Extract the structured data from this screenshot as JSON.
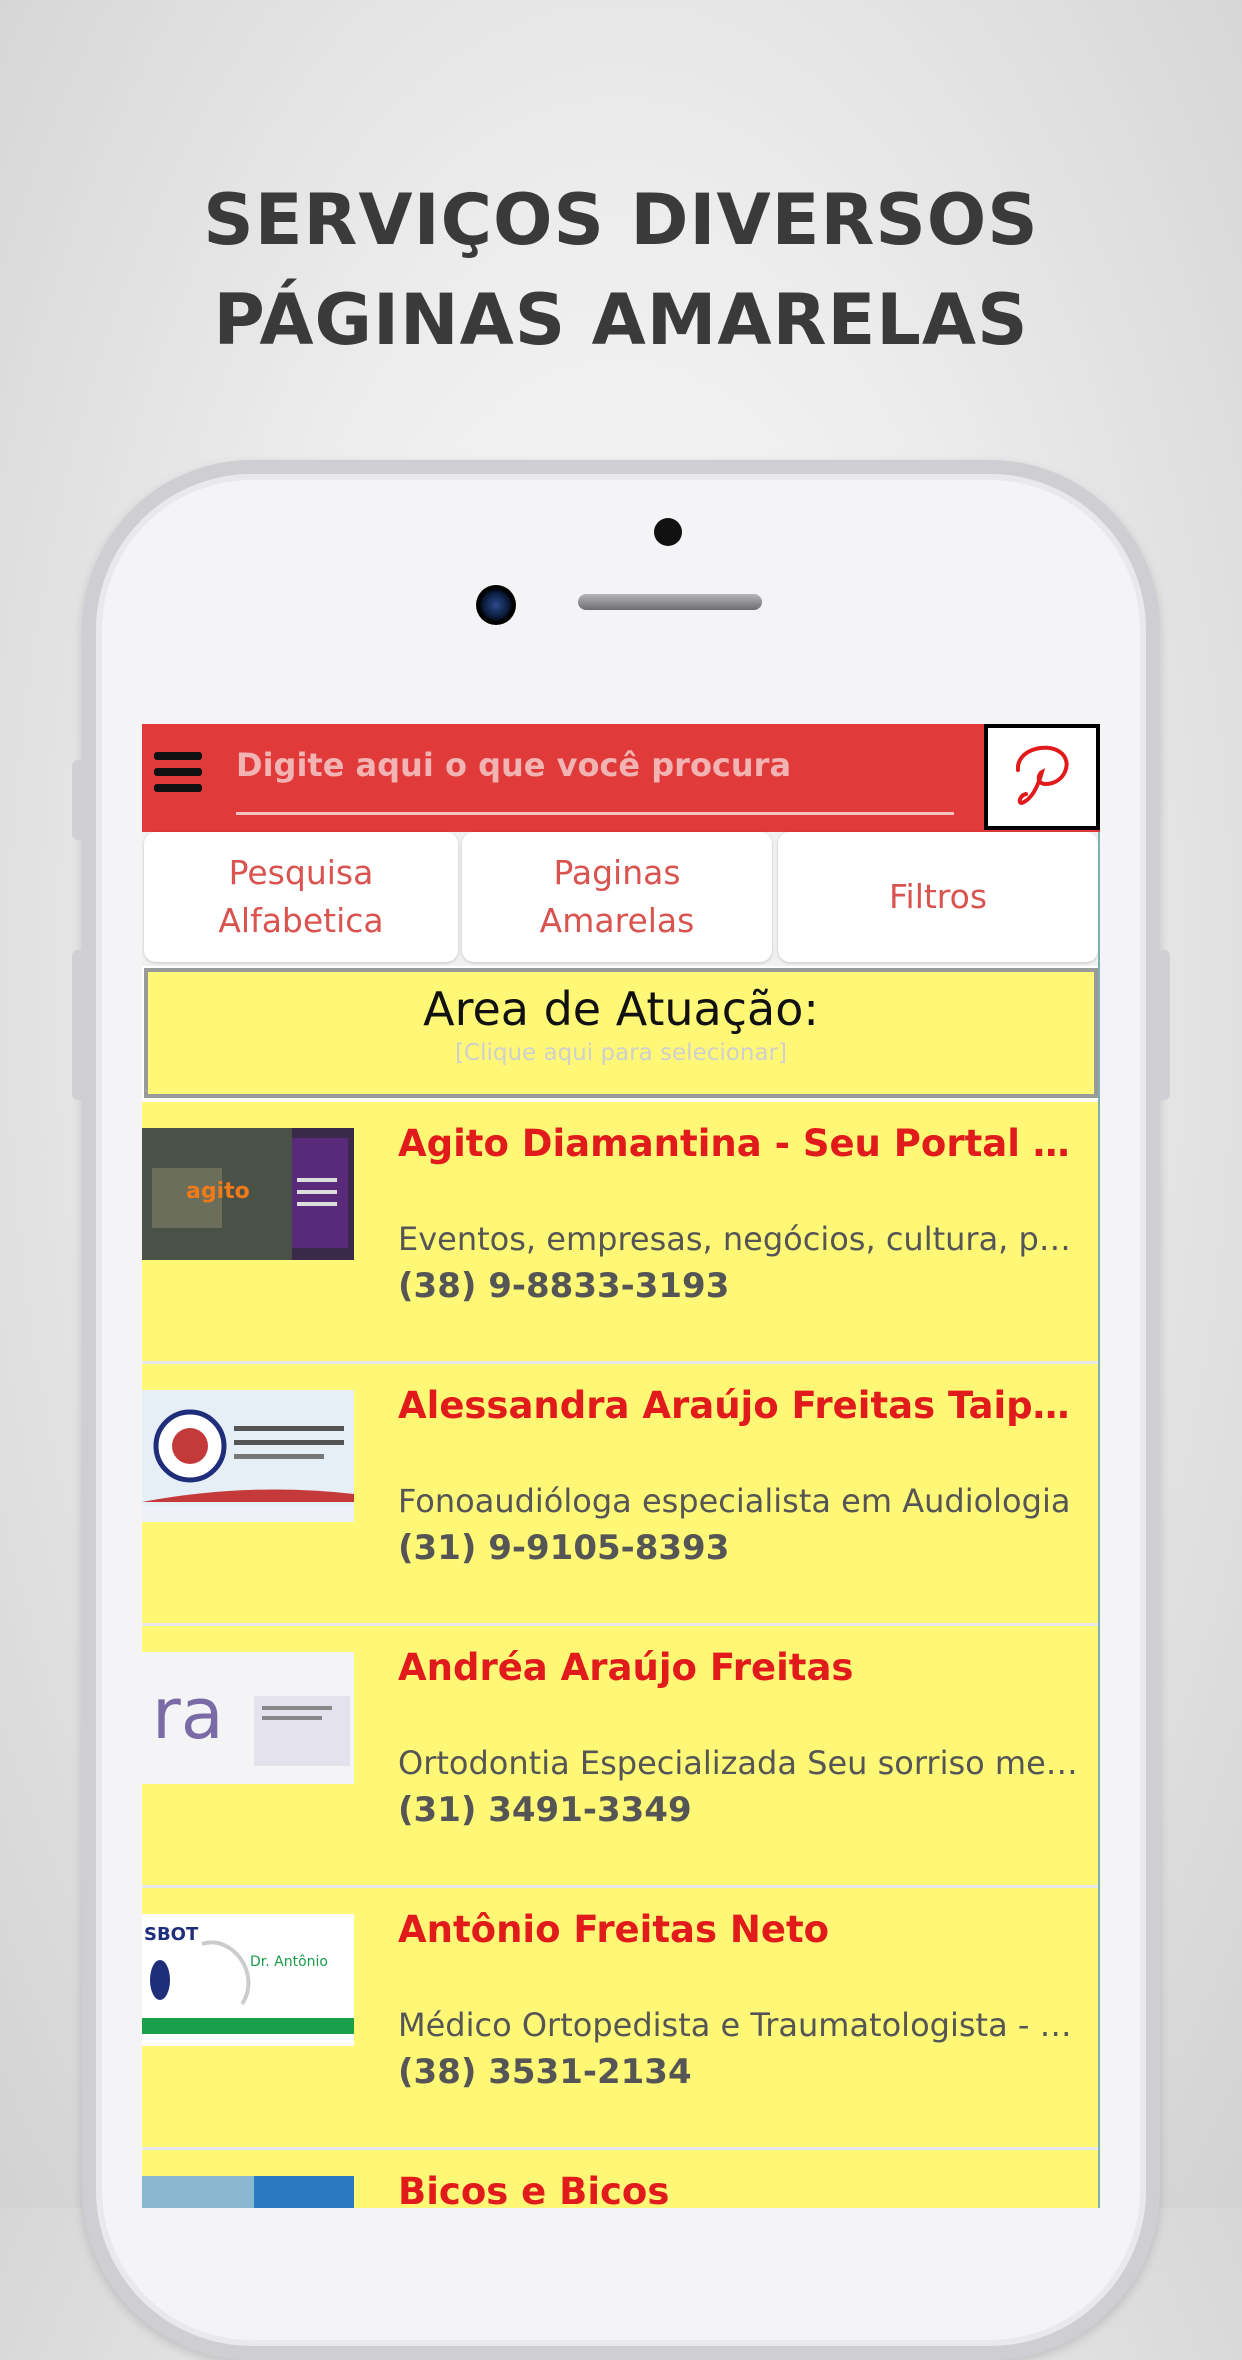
{
  "headline": {
    "line1": "SERVIÇOS DIVERSOS",
    "line2": "PÁGINAS AMARELAS"
  },
  "colors": {
    "topbar": "#e03a3a",
    "yellow": "#fef876",
    "title_red": "#e11b1b",
    "tab_text": "#d9534f"
  },
  "topbar": {
    "menu_icon": "hamburger-icon",
    "search_placeholder": "Digite aqui o que você procura",
    "logo_icon": "app-logo-icon"
  },
  "tabs": [
    {
      "label": "Pesquisa\nAlfabetica"
    },
    {
      "label": "Paginas\nAmarelas"
    },
    {
      "label": "Filtros"
    }
  ],
  "area": {
    "title": "Area de Atuação:",
    "hint": "[Clique aqui para selecionar]"
  },
  "listings": [
    {
      "title": "Agito Diamantina - Seu Portal de Eventos",
      "description": "Eventos, empresas, negócios, cultura, passeios",
      "phone": "(38) 9-8833-3193"
    },
    {
      "title": "Alessandra Araújo Freitas Taipina",
      "description": "Fonoaudióloga especialista em Audiologia",
      "phone": "(31) 9-9105-8393"
    },
    {
      "title": "Andréa Araújo Freitas",
      "description": "Ortodontia Especializada Seu sorriso merece",
      "phone": "(31) 3491-3349"
    },
    {
      "title": "Antônio Freitas Neto",
      "description": "Médico Ortopedista e Traumatologista - SBOT",
      "phone": "(38) 3531-2134"
    },
    {
      "title": "Bicos e Bicos",
      "description": "",
      "phone": ""
    }
  ]
}
